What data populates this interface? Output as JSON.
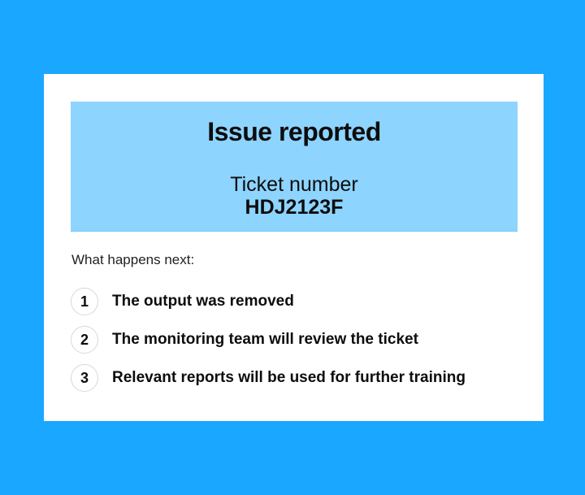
{
  "banner": {
    "title": "Issue reported",
    "ticket_label": "Ticket number",
    "ticket_number": "HDJ2123F"
  },
  "next": {
    "label": "What happens next:",
    "steps": [
      {
        "number": "1",
        "text": "The output was removed"
      },
      {
        "number": "2",
        "text": "The monitoring team will review the ticket"
      },
      {
        "number": "3",
        "text": "Relevant reports will be used for further training"
      }
    ]
  },
  "colors": {
    "background": "#1aa7ff",
    "card": "#ffffff",
    "banner": "#8dd4ff"
  }
}
